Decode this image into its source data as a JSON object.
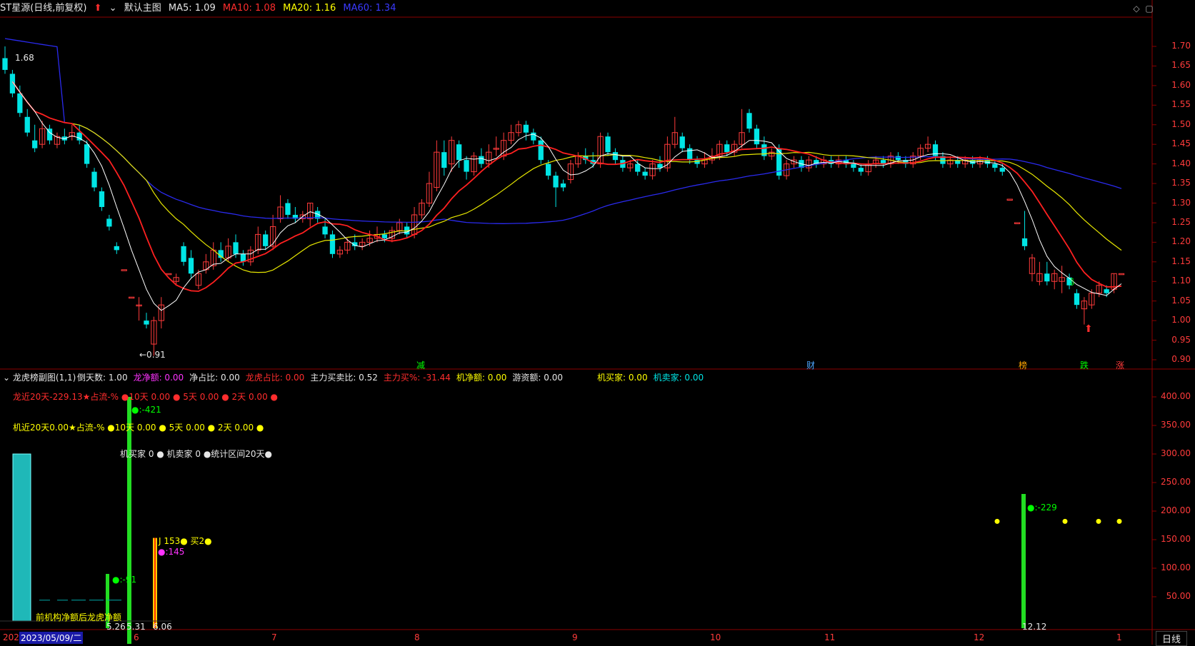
{
  "header": {
    "title": "ST星源(日线,前复权)",
    "main_label": "默认主图",
    "ma5": "MA5: 1.09",
    "ma10": "MA10: 1.08",
    "ma20": "MA20: 1.16",
    "ma60": "MA60: 1.34"
  },
  "price_axis": [
    "1.70",
    "1.65",
    "1.60",
    "1.55",
    "1.50",
    "1.45",
    "1.40",
    "1.35",
    "1.30",
    "1.25",
    "1.20",
    "1.15",
    "1.10",
    "1.05",
    "1.00",
    "0.95",
    "0.90"
  ],
  "annotations": {
    "high": "1.68",
    "low": "←0.91"
  },
  "event_tags": [
    {
      "text": "减",
      "color": "#00ff00"
    },
    {
      "text": "财",
      "color": "#4da6ff"
    },
    {
      "text": "榜",
      "color": "#ffa500"
    },
    {
      "text": "跌",
      "color": "#00ff00"
    },
    {
      "text": "涨",
      "color": "#ff3b3b"
    }
  ],
  "sub_header": {
    "title": "龙虎榜副图(1,1)",
    "items": [
      {
        "text": "倒天数: 1.00",
        "color": "#e6e6e6"
      },
      {
        "text": "龙净额: 0.00",
        "color": "#ff33ff"
      },
      {
        "text": "净占比: 0.00",
        "color": "#e6e6e6"
      },
      {
        "text": "龙虎占比: 0.00",
        "color": "#ff2d2d"
      },
      {
        "text": "主力买卖比: 0.52",
        "color": "#e6e6e6"
      },
      {
        "text": "主力买%: -31.44",
        "color": "#ff2d2d"
      },
      {
        "text": "机净额: 0.00",
        "color": "#ffff00"
      },
      {
        "text": "游资额: 0.00",
        "color": "#e6e6e6"
      },
      {
        "text": "机买家: 0.00",
        "color": "#ffff00"
      },
      {
        "text": "机卖家: 0.00",
        "color": "#00e5e5"
      }
    ]
  },
  "sub_lines": {
    "line1": "龙近20天-229.13★占流-% ●10天 0.00 ●  5天 0.00 ●  2天 0.00 ●",
    "line2": "机近20天0.00★占流-% ●10天 0.00 ●  5天 0.00 ●  2天 0.00 ●",
    "line3": "机买家 0 ● 机卖家 0 ●统计区间20天●"
  },
  "sub_axis": [
    "400.00",
    "350.00",
    "300.00",
    "250.00",
    "200.00",
    "150.00",
    "100.00",
    "50.00"
  ],
  "sub_annotations": {
    "a1": "●:-421",
    "a2": "●:-91",
    "a3": "J 153● 买2●",
    "a4": "●:145",
    "a5": "●:-229",
    "legend": "前机构净额后龙虎净额",
    "v1": "5.26",
    "v2": "5.31",
    "v3": "6.06",
    "v4": "12.12"
  },
  "date_axis": {
    "current": "2023/05/09/二",
    "prefix": "202",
    "months": [
      "6",
      "7",
      "8",
      "9",
      "10",
      "11",
      "12",
      "1"
    ],
    "period": "日线"
  },
  "colors": {
    "up": "#ff3b3b",
    "down": "#00e5e5",
    "ma5": "#ffffff",
    "ma10": "#ff2020",
    "ma20": "#e6e600",
    "ma60": "#2a2aee"
  }
}
